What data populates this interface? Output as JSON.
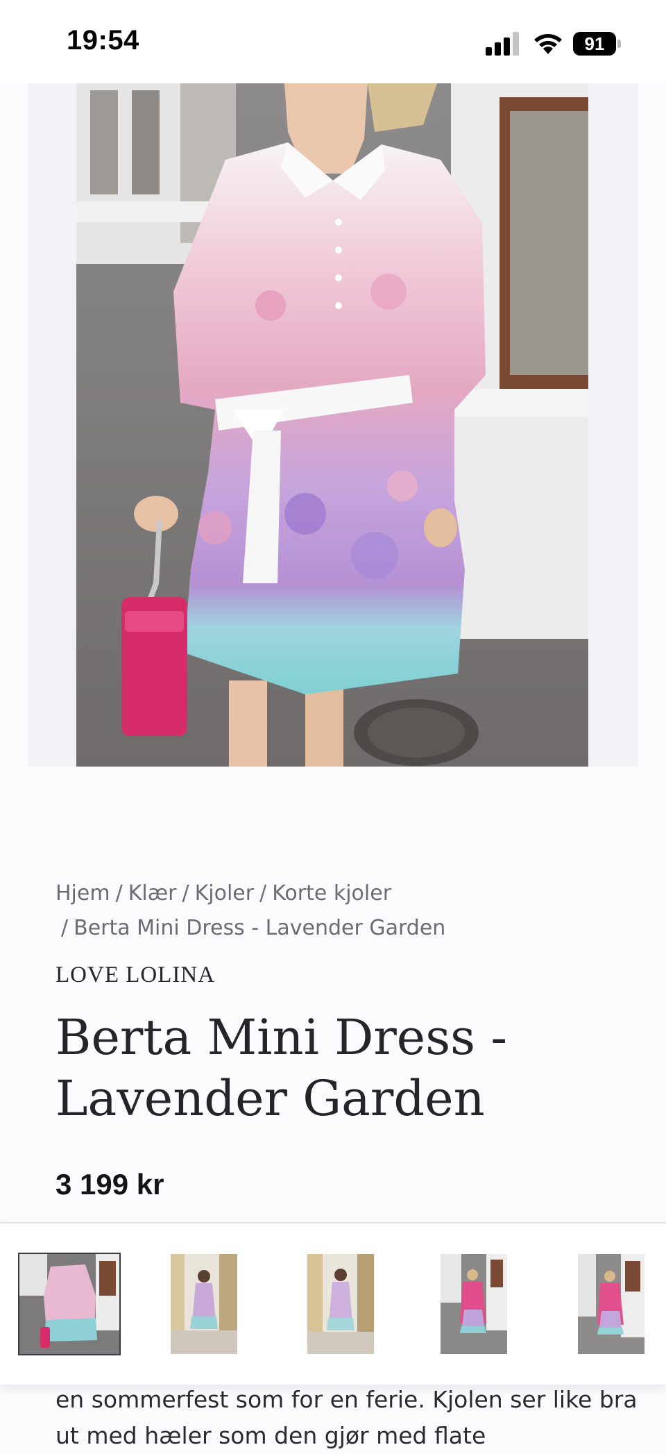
{
  "status_bar": {
    "time": "19:54",
    "battery": "91",
    "icons": [
      "cellular-signal-icon",
      "wifi-icon",
      "battery-icon"
    ]
  },
  "hero": {
    "image": "product-photo-woman-in-floral-shirt-dress-with-pink-handbag"
  },
  "breadcrumb": {
    "items": [
      "Hjem",
      "Klær",
      "Kjoler",
      "Korte kjoler"
    ],
    "separator": "/",
    "current": "Berta Mini Dress - Lavender Garden"
  },
  "product": {
    "brand": "LOVE LOLINA",
    "title": "Berta Mini Dress - Lavender Garden",
    "price": "3 199 kr"
  },
  "gallery": {
    "selected_index": 0,
    "thumbnails": [
      "product-photo-front-closeup",
      "product-photo-street-full",
      "product-photo-street-full-2",
      "product-photo-pink-blazer",
      "product-photo-pink-blazer-2"
    ]
  },
  "description": {
    "text": "en sommerfest som for en ferie. Kjolen ser like bra ut med hæler som den gjør med flate"
  },
  "colors": {
    "background": "#fbfbfd",
    "text": "#1f1f24",
    "muted": "#6b6b72",
    "handbag": "#d62d6a",
    "dress_lavender": "#b89bd8",
    "dress_pink": "#e9a2bd",
    "dress_turquoise": "#7fd3d6"
  }
}
